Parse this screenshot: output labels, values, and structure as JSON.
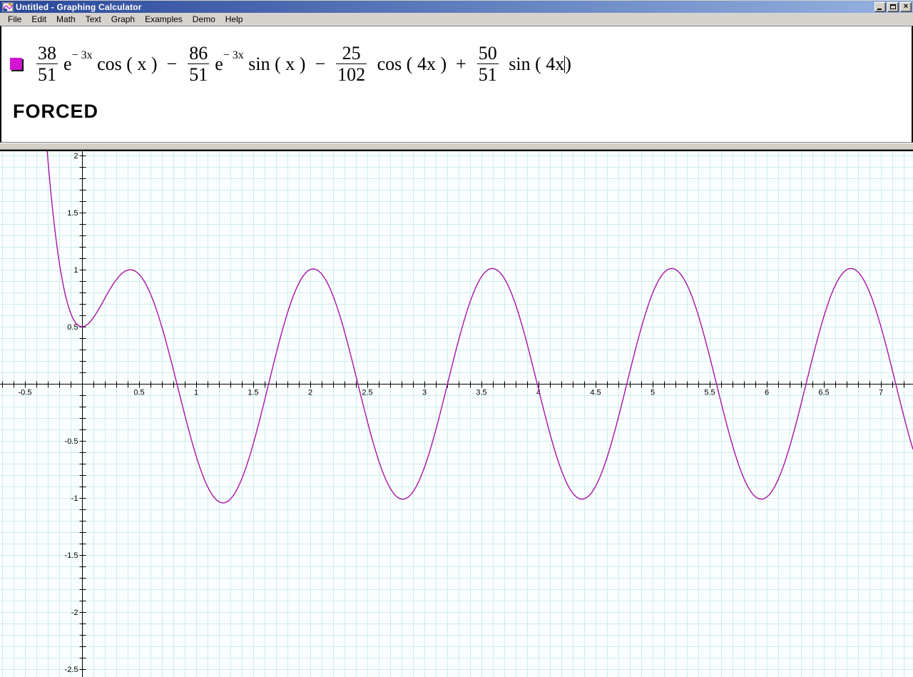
{
  "window": {
    "title": "Untitled - Graphing Calculator",
    "controls": {
      "minimize": "minimize",
      "restore": "restore",
      "close": "×"
    }
  },
  "menu": {
    "items": [
      "File",
      "Edit",
      "Math",
      "Text",
      "Graph",
      "Examples",
      "Demo",
      "Help"
    ]
  },
  "colors": {
    "titlebar_left": "#29489a",
    "titlebar_right": "#95b2e0",
    "curve": "#a813a8",
    "swatch": "#d414d4",
    "grid": "#cdecec",
    "graph_bg": "#fbfefe",
    "axis": "#000000"
  },
  "equation": {
    "annotation": "FORCED",
    "swatch_color": "#d414d4",
    "expression_plain": "38/51 e^(-3x) cos(x) - 86/51 e^(-3x) sin(x) - 25/102 cos(4x) + 50/51 sin(4x)",
    "parts": [
      {
        "type": "frac",
        "num": "38",
        "den": "51"
      },
      {
        "type": "text",
        "t": "e"
      },
      {
        "type": "sup",
        "t": "− 3x"
      },
      {
        "type": "text",
        "t": " cos ( x )  −  "
      },
      {
        "type": "frac",
        "num": "86",
        "den": "51"
      },
      {
        "type": "text",
        "t": "e"
      },
      {
        "type": "sup",
        "t": "− 3x"
      },
      {
        "type": "text",
        "t": " sin ( x )  −  "
      },
      {
        "type": "frac",
        "num": "25",
        "den": "102"
      },
      {
        "type": "text",
        "t": " cos ( 4x )  +  "
      },
      {
        "type": "frac",
        "num": "50",
        "den": "51"
      },
      {
        "type": "text",
        "t": " sin ( 4x"
      },
      {
        "type": "cursor"
      },
      {
        "type": "text",
        "t": ")"
      }
    ]
  },
  "chart_data": {
    "type": "line",
    "title": "",
    "xlabel": "",
    "ylabel": "",
    "expression": "f(x) = (38/51)e^(-3x)cos(x) - (86/51)e^(-3x)sin(x) - (25/102)cos(4x) + (50/51)sin(4x)",
    "coeffs": {
      "a": 0.7450980392,
      "b": -1.6862745098,
      "c": -0.2450980392,
      "d": 0.9803921569,
      "decay": 3,
      "w": 4
    },
    "coeff_fractions": {
      "a": "38/51",
      "b": "-86/51",
      "c": "-25/102",
      "d": "50/51"
    },
    "x_range": [
      -0.71875,
      7.28125
    ],
    "y_range": [
      -2.56875,
      2.0375
    ],
    "grid_step": 0.1,
    "tick_step": 0.1,
    "label_step": 0.5,
    "x_ticks": [
      [
        -0.5,
        "-0.5"
      ],
      [
        0.5,
        "0.5"
      ],
      [
        1,
        "1"
      ],
      [
        1.5,
        "1.5"
      ],
      [
        2,
        "2"
      ],
      [
        2.5,
        "2.5"
      ],
      [
        3,
        "3"
      ],
      [
        3.5,
        "3.5"
      ],
      [
        4,
        "4"
      ],
      [
        4.5,
        "4.5"
      ],
      [
        5,
        "5"
      ],
      [
        5.5,
        "5.5"
      ],
      [
        6,
        "6"
      ],
      [
        6.5,
        "6.5"
      ],
      [
        7,
        "7"
      ]
    ],
    "y_ticks": [
      [
        2,
        "2"
      ],
      [
        1.5,
        "1.5"
      ],
      [
        1,
        "1"
      ],
      [
        0.5,
        "0.5"
      ],
      [
        -0.5,
        "-0.5"
      ],
      [
        -1,
        "-1"
      ],
      [
        -1.5,
        "-1.5"
      ],
      [
        -2,
        "-2"
      ],
      [
        -2.5,
        "-2.5"
      ]
    ],
    "grid_on": true,
    "legend_position": "none",
    "curve_color": "#a813a8",
    "grid_color": "#cdecec",
    "bg_color": "#fbfefe",
    "axis_color": "#000000",
    "key_points": {
      "f_at_0": 0.5,
      "steady_amplitude": 1.0,
      "steady_period": 1.5708,
      "first_local_max": [
        0.45,
        1.0
      ]
    }
  }
}
